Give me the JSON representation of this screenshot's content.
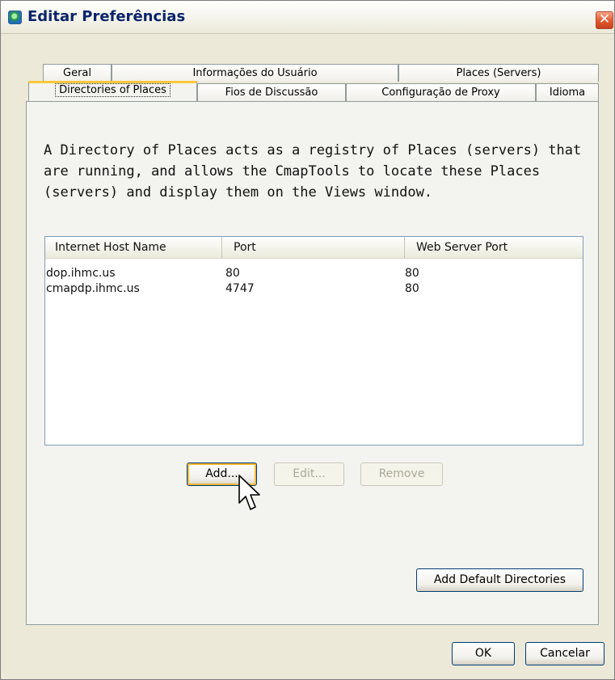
{
  "window": {
    "title": "Editar Preferências",
    "close_glyph": "✕"
  },
  "tabs": {
    "row1": [
      {
        "label": "Geral"
      },
      {
        "label": "Informações do Usuário"
      },
      {
        "label": "Places (Servers)"
      }
    ],
    "row2": [
      {
        "label": "Directories of Places",
        "active": true
      },
      {
        "label": "Fios de Discussão"
      },
      {
        "label": "Configuração de Proxy"
      },
      {
        "label": "Idioma"
      }
    ]
  },
  "description": "A Directory of Places acts as a registry of Places (servers) that are running, and allows the CmapTools to locate these Places (servers) and display them on the Views window.",
  "table": {
    "columns": [
      "Internet Host Name",
      "Port",
      "Web Server Port"
    ],
    "rows": [
      [
        "dop.ihmc.us",
        "80",
        "80"
      ],
      [
        "cmapdp.ihmc.us",
        "4747",
        "80"
      ]
    ]
  },
  "buttons": {
    "add": "Add...",
    "edit": "Edit...",
    "remove": "Remove",
    "add_default": "Add Default Directories",
    "ok": "OK",
    "cancel": "Cancelar"
  },
  "colors": {
    "title_text": "#0a246a",
    "active_tab_accent": "#ffc83c",
    "close_button": "#e2582d",
    "window_bg": "#ece9d8"
  },
  "icons": {
    "app": "cmaptools-app-icon",
    "close": "close-icon",
    "cursor": "mouse-pointer-icon"
  }
}
